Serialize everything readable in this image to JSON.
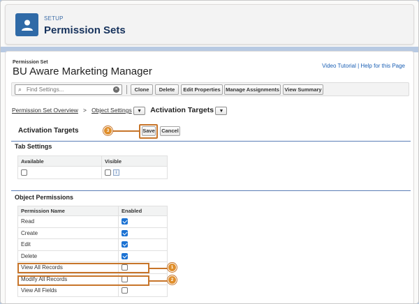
{
  "header": {
    "eyebrow": "SETUP",
    "title": "Permission Sets",
    "icon": "user-icon"
  },
  "page": {
    "ps_label": "Permission Set",
    "ps_name": "BU Aware Marketing Manager",
    "help_links": "Video Tutorial | Help for this Page"
  },
  "toolbar": {
    "search_placeholder": "Find Settings...",
    "clone": "Clone",
    "delete": "Delete",
    "edit_properties": "Edit Properties",
    "manage_assignments": "Manage Assignments",
    "view_summary": "View Summary"
  },
  "breadcrumb": {
    "overview": "Permission Set Overview",
    "sep": ">",
    "object_settings": "Object Settings",
    "current": "Activation Targets"
  },
  "section": {
    "title": "Activation Targets",
    "save": "Save",
    "cancel": "Cancel"
  },
  "tab_settings": {
    "title": "Tab Settings",
    "col_available": "Available",
    "col_visible": "Visible",
    "available_checked": false,
    "visible_checked": false
  },
  "object_permissions": {
    "title": "Object Permissions",
    "col_name": "Permission Name",
    "col_enabled": "Enabled",
    "rows": [
      {
        "name": "Read",
        "enabled": true
      },
      {
        "name": "Create",
        "enabled": true
      },
      {
        "name": "Edit",
        "enabled": true
      },
      {
        "name": "Delete",
        "enabled": true
      },
      {
        "name": "View All Records",
        "enabled": false
      },
      {
        "name": "Modify All Records",
        "enabled": false
      },
      {
        "name": "View All Fields",
        "enabled": false
      }
    ]
  },
  "callouts": [
    "1",
    "2",
    "3"
  ],
  "colors": {
    "accent": "#2f6aa7",
    "callout": "#e08f2c",
    "checkbox": "#1b72d3"
  }
}
